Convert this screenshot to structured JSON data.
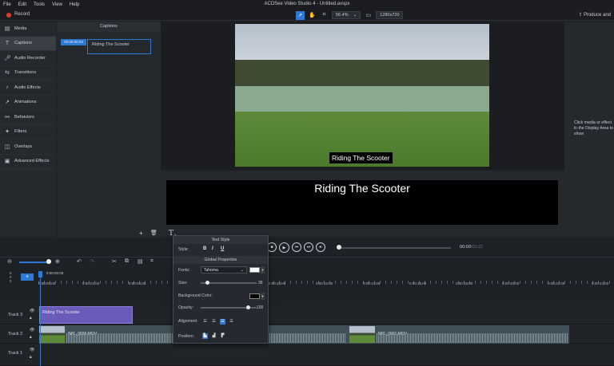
{
  "app": {
    "title": "ACDSee Video Studio 4 - Untitled.avspx",
    "menu": [
      "File",
      "Edit",
      "Tools",
      "View",
      "Help"
    ],
    "record": "Record",
    "produce": "Produce and"
  },
  "toolbar": {
    "zoom": "56.4%",
    "resolution": "1280x720"
  },
  "sidebar": {
    "items": [
      {
        "label": "Media",
        "icon": "media-icon"
      },
      {
        "label": "Captions",
        "icon": "text-icon"
      },
      {
        "label": "Audio Recorder",
        "icon": "mic-icon"
      },
      {
        "label": "Transitions",
        "icon": "transitions-icon"
      },
      {
        "label": "Audio Effects",
        "icon": "speaker-icon"
      },
      {
        "label": "Animations",
        "icon": "animation-icon"
      },
      {
        "label": "Behaviors",
        "icon": "behaviors-icon"
      },
      {
        "label": "Filters",
        "icon": "filters-icon"
      },
      {
        "label": "Overlays",
        "icon": "overlays-icon"
      },
      {
        "label": "Advanced Effects",
        "icon": "advanced-effects-icon"
      }
    ],
    "active": "Captions"
  },
  "captions": {
    "header": "Captions",
    "time": "00:00:00;03",
    "text": "Riding The Scooter"
  },
  "preview": {
    "caption": "Riding The Scooter"
  },
  "rightpanel": {
    "hint": "Click media or effect in the Display Area to show"
  },
  "editor": {
    "text": "Riding The Scooter"
  },
  "player": {
    "current": "00:00",
    "total": "/00:22"
  },
  "textstyle": {
    "title": "Text Style",
    "style_label": "Style:",
    "bold": "B",
    "italic": "I",
    "underline": "U",
    "global_title": "Global Properties",
    "fonts_label": "Fonts:",
    "font": "Tahoma",
    "font_color": "#ffffff",
    "size_label": "Size:",
    "size": "36",
    "size_fraction": 0.12,
    "bgcolor_label": "Background Color:",
    "bgcolor": "#000000",
    "opacity_label": "Opacity:",
    "opacity": "100",
    "opacity_fraction": 1.0,
    "alignment_label": "Alignment:",
    "position_label": "Position:"
  },
  "timeline": {
    "playhead": "0:00:00;03",
    "ruler": [
      "0:00:00;00",
      "0:00:02;00",
      "0:00:04;00",
      "0:00:10;00",
      "0:00:12;00",
      "0:00:14;00",
      "0:00:16;00",
      "0:00:18;00",
      "0:00:20;00",
      "0:00:22;00",
      "0:00:24;00"
    ],
    "tracks": [
      {
        "name": "Track 3"
      },
      {
        "name": "Track 2"
      },
      {
        "name": "Track 1"
      }
    ],
    "caption_clip": "Riding The Scooter",
    "video_clips": [
      "IMG_0029.MOV",
      "IMG_0031.MOV"
    ],
    "stack": [
      "0",
      "0",
      "0",
      "0:0"
    ]
  }
}
